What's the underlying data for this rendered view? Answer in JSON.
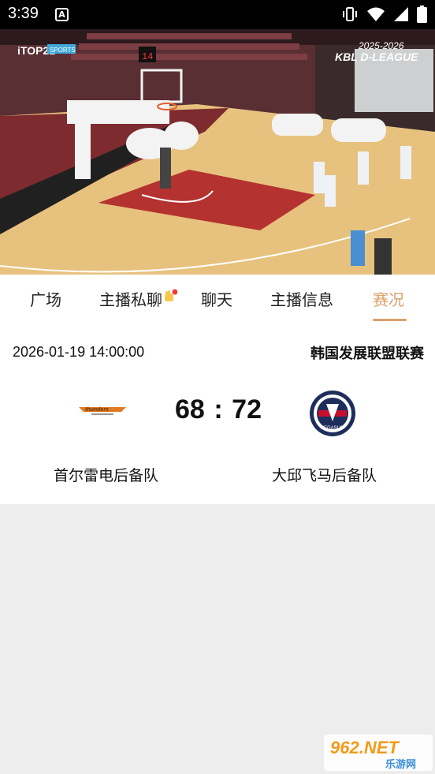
{
  "status_bar": {
    "time": "3:39",
    "notification_icon": "a-notification-icon",
    "icons": [
      "vibrate-icon",
      "wifi-icon",
      "signal-icon",
      "battery-icon"
    ]
  },
  "video": {
    "broadcaster_logo": "iTOP21",
    "broadcaster_tag": "SPORTS",
    "league_logo_text": "KBL D-LEAGUE",
    "season_text": "2025-2026",
    "shot_clock": "14"
  },
  "tabs": [
    {
      "label": "广场",
      "active": false
    },
    {
      "label": "主播私聊",
      "active": false
    },
    {
      "label": "聊天",
      "active": false
    },
    {
      "label": "主播信息",
      "active": false
    },
    {
      "label": "赛况",
      "active": true
    }
  ],
  "match": {
    "datetime": "2026-01-19 14:00:00",
    "league": "韩国发展联盟联赛",
    "home_score": "68",
    "separator": ":",
    "away_score": "72",
    "home_team": "首尔雷电后备队",
    "away_team": "大邱飞马后备队",
    "home_logo_text": "thunders",
    "away_logo_text": "PEGASUS"
  },
  "watermark": {
    "main": "962.NET",
    "sub": "乐游网"
  },
  "colors": {
    "accent": "#d9a06a",
    "background": "#ededed"
  }
}
